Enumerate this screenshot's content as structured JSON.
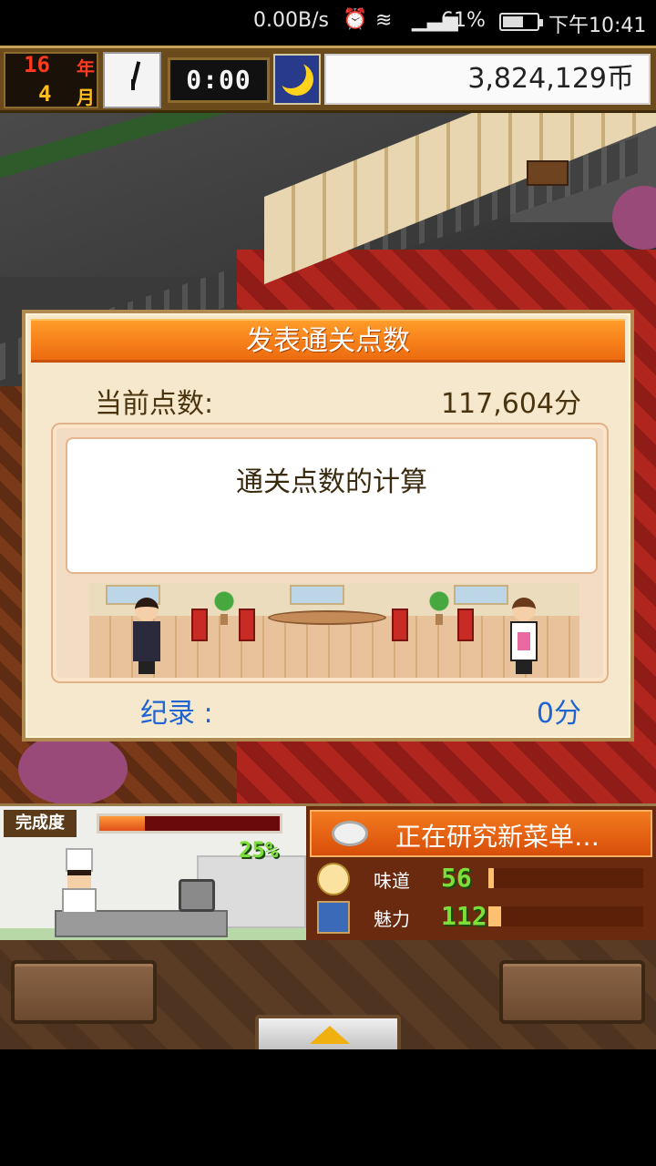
{
  "status_bar": {
    "net_speed": "0.00B/s",
    "alarm_icon": "alarm-icon",
    "wifi_icon": "wifi-icon",
    "signal_icon": "signal-icon",
    "battery_pct": "61%",
    "battery_level": 0.61,
    "time": "下午10:41"
  },
  "hud": {
    "year_num": "16",
    "year_label": "年",
    "month_num": "4",
    "month_label": "月",
    "timer": "0:00",
    "money": "3,824,129币"
  },
  "dialog": {
    "title": "发表通关点数",
    "current_score_label": "当前点数:",
    "current_score_value": "117,604分",
    "calc_text": "通关点数的计算",
    "record_label": "纪录 :",
    "record_value": "0分"
  },
  "kitchen": {
    "label": "完成度",
    "progress": 0.25,
    "progress_text": "25%"
  },
  "research": {
    "title": "正在研究新菜单…",
    "stats": [
      {
        "label": "味道",
        "value": "56",
        "icon": "taste-icon"
      },
      {
        "label": "魅力",
        "value": "112",
        "icon": "charm-icon"
      }
    ]
  },
  "colors": {
    "dialog_title_orange": "#f6801a",
    "record_blue": "#1e64d2",
    "stat_green": "#7dde3a"
  }
}
